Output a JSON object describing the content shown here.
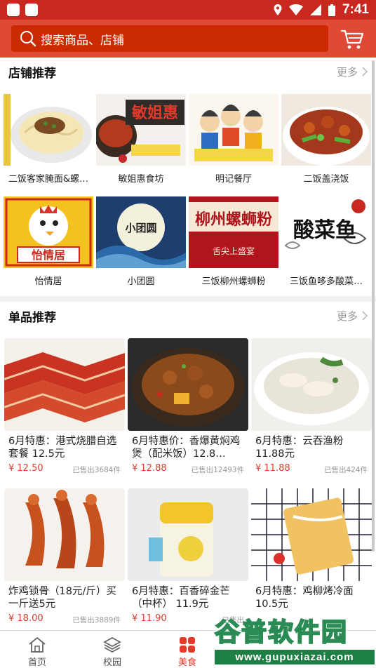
{
  "status_bar": {
    "time": "7:41"
  },
  "search": {
    "placeholder": "搜索商品、店铺"
  },
  "shop_section": {
    "title": "店铺推荐",
    "more": "更多",
    "shops": [
      {
        "name": "二饭客家腌面&螺…"
      },
      {
        "name": "敏姐惠食坊",
        "sign": "敏姐惠"
      },
      {
        "name": "明记餐厅"
      },
      {
        "name": "二饭盖浇饭"
      },
      {
        "name": "怡情居",
        "sign": "怡情居"
      },
      {
        "name": "小团圆",
        "sign": "小团圆"
      },
      {
        "name": "三饭柳州螺蛳粉",
        "sign": "柳州螺蛳粉",
        "sub": "舌尖上盛宴"
      },
      {
        "name": "三饭鱼哆多酸菜…",
        "sign": "酸菜鱼"
      }
    ]
  },
  "product_section": {
    "title": "单品推荐",
    "more": "更多",
    "products": [
      {
        "title": "6月特惠：港式烧腊自选套餐  12.5元",
        "price": "¥ 12.50",
        "sold": "已售出3684件"
      },
      {
        "title": "6月特惠价：香爆黄焖鸡煲（配米饭）12.8…",
        "price": "¥ 12.88",
        "sold": "已售出12493件"
      },
      {
        "title": "6月特惠：云吞渔粉 11.88元",
        "price": "¥ 11.88",
        "sold": "已售出424件"
      },
      {
        "title": "炸鸡锁骨（18元/斤）买一斤送5元",
        "price": "¥ 18.00",
        "sold": "已售出3889件"
      },
      {
        "title": "6月特惠：百香碎金芒（中杯） 11.9元",
        "price": "¥ 11.90",
        "sold": "已售出"
      },
      {
        "title": "6月特惠：鸡柳烤冷面 10.5元",
        "price": "",
        "sold": ""
      }
    ]
  },
  "tabs": [
    {
      "label": "首页",
      "icon": "home-icon"
    },
    {
      "label": "校园",
      "icon": "layers-icon"
    },
    {
      "label": "美食",
      "icon": "food-grid-icon"
    }
  ],
  "watermark": {
    "text": "谷普软件园",
    "url": "www.gupuxiazai.com"
  },
  "colors": {
    "brand": "#df4a37",
    "search_bg": "#cc2a00",
    "price": "#e53a2a"
  }
}
